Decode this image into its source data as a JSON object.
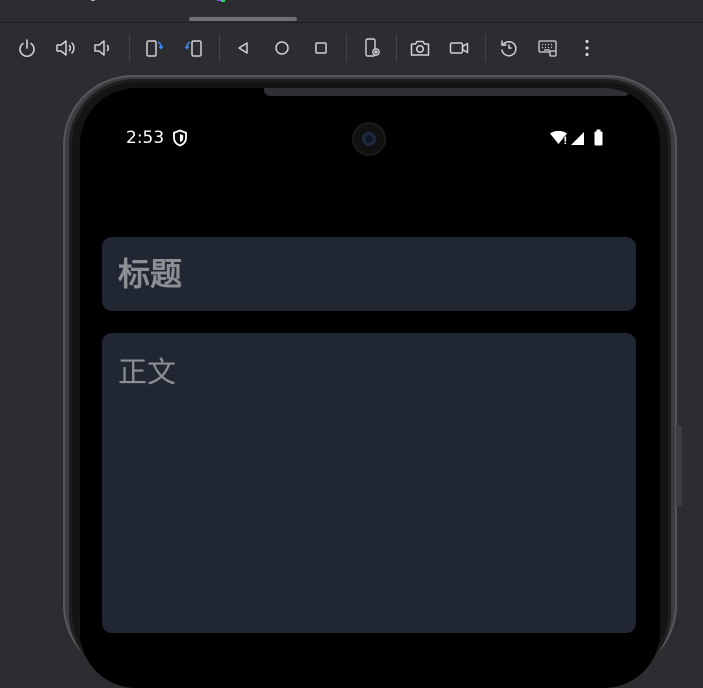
{
  "toolbar": {
    "buttons": [
      {
        "icon": "power-icon"
      },
      {
        "icon": "volume-up-icon"
      },
      {
        "icon": "volume-down-icon"
      },
      {
        "icon": "rotate-left-icon"
      },
      {
        "icon": "rotate-right-icon"
      },
      {
        "icon": "back-icon"
      },
      {
        "icon": "home-icon"
      },
      {
        "icon": "overview-icon"
      },
      {
        "icon": "device-settings-icon"
      },
      {
        "icon": "screenshot-icon"
      },
      {
        "icon": "screen-record-icon"
      },
      {
        "icon": "reset-icon"
      },
      {
        "icon": "keyboard-icon"
      },
      {
        "icon": "more-icon"
      }
    ],
    "accent_color": "#3d8bfd"
  },
  "device": {
    "status_bar": {
      "time": "2:53"
    }
  },
  "app": {
    "title_placeholder": "标题",
    "body_placeholder": "正文",
    "card_color": "#202733",
    "placeholder_color": "#8b8f94"
  }
}
